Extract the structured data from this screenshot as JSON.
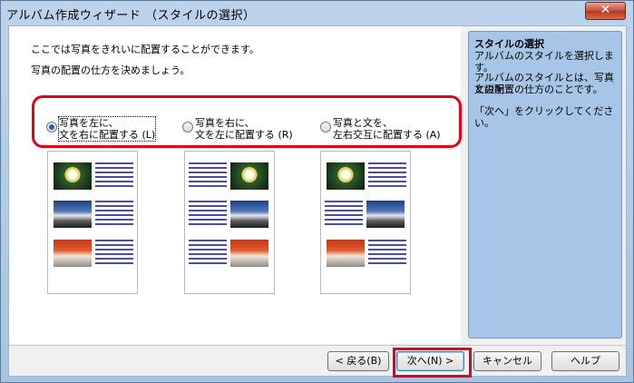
{
  "window": {
    "title": "アルバム作成ウィザード （スタイルの選択）",
    "close_label": "✕"
  },
  "main": {
    "intro_line1": "ここでは写真をきれいに配置することができます。",
    "intro_line2": "写真の配置の仕方を決めましょう。"
  },
  "options": [
    {
      "line1": "写真を左に、",
      "line2": "文を右に配置する (L)",
      "selected": true
    },
    {
      "line1": "写真を右に、",
      "line2": "文を左に配置する (R)",
      "selected": false
    },
    {
      "line1": "写真と文を、",
      "line2": "左右交互に配置する (A)",
      "selected": false
    }
  ],
  "side_panel": {
    "title": "スタイルの選択",
    "line1": "アルバムのスタイルを選択します。",
    "line2a": "アルバムのスタイルとは、写真と説明",
    "line2b": "文の配置の仕方のことです。",
    "line3": "「次へ」をクリックしてください。"
  },
  "buttons": {
    "back": "< 戻る(B)",
    "next": "次へ(N) >",
    "cancel": "キャンセル",
    "help": "ヘルプ"
  },
  "colors": {
    "highlight": "#e2001a",
    "side_panel": "#a7c5e6",
    "text_lines": "#4b4ba8"
  }
}
